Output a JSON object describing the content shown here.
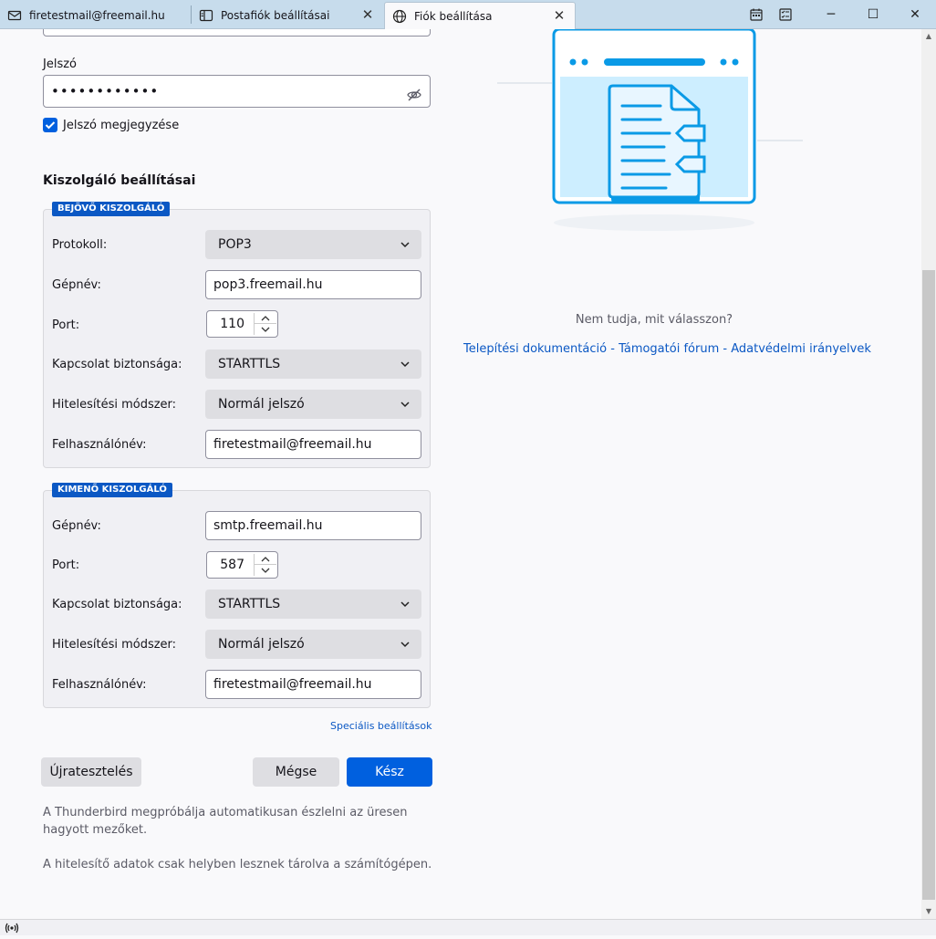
{
  "tabs": [
    {
      "label": "firetestmail@freemail.hu",
      "icon": "mail-icon"
    },
    {
      "label": "Postafiók beállításai",
      "icon": "account-settings-icon"
    },
    {
      "label": "Fiók beállítása",
      "icon": "globe-icon"
    }
  ],
  "window_controls": {
    "minimize": "─",
    "maximize": "☐",
    "close": "✕"
  },
  "password": {
    "label": "Jelszó",
    "value": "••••••••••••",
    "remember_label": "Jelszó megjegyzése"
  },
  "server_section_title": "Kiszolgáló beállításai",
  "incoming": {
    "legend": "BEJÖVŐ KISZOLGÁLÓ",
    "protocol_label": "Protokoll:",
    "protocol_value": "POP3",
    "hostname_label": "Gépnév:",
    "hostname_value": "pop3.freemail.hu",
    "port_label": "Port:",
    "port_value": "110",
    "security_label": "Kapcsolat biztonsága:",
    "security_value": "STARTTLS",
    "auth_label": "Hitelesítési módszer:",
    "auth_value": "Normál jelszó",
    "username_label": "Felhasználónév:",
    "username_value": "firetestmail@freemail.hu"
  },
  "outgoing": {
    "legend": "KIMENŐ KISZOLGÁLÓ",
    "hostname_label": "Gépnév:",
    "hostname_value": "smtp.freemail.hu",
    "port_label": "Port:",
    "port_value": "587",
    "security_label": "Kapcsolat biztonsága:",
    "security_value": "STARTTLS",
    "auth_label": "Hitelesítési módszer:",
    "auth_value": "Normál jelszó",
    "username_label": "Felhasználónév:",
    "username_value": "firetestmail@freemail.hu"
  },
  "advanced_link": "Speciális beállítások",
  "buttons": {
    "retest": "Újratesztelés",
    "cancel": "Mégse",
    "done": "Kész"
  },
  "hints": {
    "autodetect": "A Thunderbird megpróbálja automatikusan észlelni az üresen hagyott mezőket.",
    "local_storage": "A hitelesítő adatok csak helyben lesznek tárolva a számítógépen."
  },
  "help": {
    "question": "Nem tudja, mit válasszon?",
    "links": [
      "Telepítési dokumentáció",
      "Támogatói fórum",
      "Adatvédelmi irányelvek"
    ],
    "separator": "-"
  },
  "colors": {
    "accent": "#0060df",
    "legend": "#0b58c4",
    "illustration": "#0a9ae6"
  }
}
